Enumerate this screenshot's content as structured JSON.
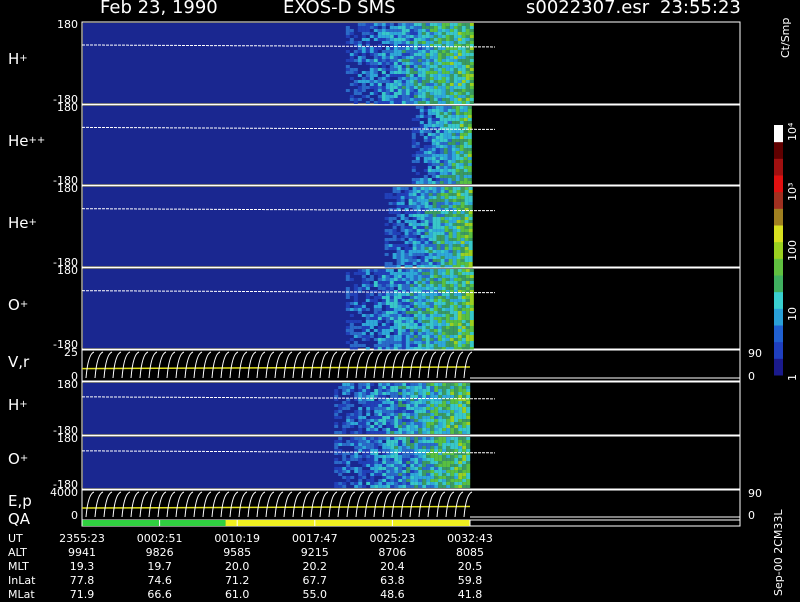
{
  "header": {
    "date": "Feb 23, 1990",
    "instrument": "EXOS-D SMS",
    "file": "s0022307.esr",
    "time": "23:55:23"
  },
  "panels": [
    {
      "name": "H",
      "sup": "+",
      "ymax": "180",
      "ymin": "-180",
      "type": "spectrogram"
    },
    {
      "name": "He",
      "sup": "++",
      "ymax": "180",
      "ymin": "-180",
      "type": "spectrogram"
    },
    {
      "name": "He",
      "sup": "+",
      "ymax": "180",
      "ymin": "-180",
      "type": "spectrogram"
    },
    {
      "name": "O",
      "sup": "+",
      "ymax": "180",
      "ymin": "-180",
      "type": "spectrogram"
    },
    {
      "name": "V,r",
      "sup": "",
      "ymax": "25",
      "ymin": "0",
      "right_max": "90",
      "right_min": "0",
      "type": "line"
    },
    {
      "name": "H",
      "sup": "+",
      "ymax": "180",
      "ymin": "-180",
      "type": "spectrogram"
    },
    {
      "name": "O",
      "sup": "+",
      "ymax": "180",
      "ymin": "-180",
      "type": "spectrogram"
    },
    {
      "name": "E,p",
      "sup": "",
      "ymax": "4000",
      "ymin": "0",
      "right_max": "90",
      "right_min": "0",
      "type": "line"
    },
    {
      "name": "QA",
      "sup": "",
      "type": "quality"
    }
  ],
  "colorbar": {
    "unit": "Ct/Smp",
    "ticks": [
      {
        "label": "1",
        "value": 1
      },
      {
        "label": "10",
        "value": 10
      },
      {
        "label": "100",
        "value": 100
      },
      {
        "label": "10³",
        "value": 1000
      },
      {
        "label": "10⁴",
        "value": 10000
      }
    ],
    "colors": [
      "#1a1a8c",
      "#1f3fbf",
      "#2060d0",
      "#2aa0d8",
      "#3ad0d0",
      "#40b060",
      "#60c040",
      "#9ad020",
      "#d8e020",
      "#a08020",
      "#a03020",
      "#e01010",
      "#a01010",
      "#600000",
      "#ffffff"
    ]
  },
  "footer": {
    "rows": [
      {
        "name": "UT",
        "values": [
          "2355:23",
          "0002:51",
          "0010:19",
          "0017:47",
          "0025:23",
          "0032:43"
        ]
      },
      {
        "name": "ALT",
        "values": [
          "9941",
          "9826",
          "9585",
          "9215",
          "8706",
          "8085"
        ]
      },
      {
        "name": "MLT",
        "values": [
          "19.3",
          "19.7",
          "20.0",
          "20.2",
          "20.4",
          "20.5"
        ]
      },
      {
        "name": "InLat",
        "values": [
          "77.8",
          "74.6",
          "71.2",
          "67.7",
          "63.8",
          "59.8"
        ]
      },
      {
        "name": "MLat",
        "values": [
          "71.9",
          "66.6",
          "61.0",
          "55.0",
          "48.6",
          "41.8"
        ]
      }
    ],
    "date_label": "Sep-00  2CM33L"
  },
  "chart_data": {
    "type": "heatmap",
    "title": "Feb 23, 1990   EXOS-D SMS",
    "x_ticks": [
      "2355:23",
      "0002:51",
      "0010:19",
      "0017:47",
      "0025:23",
      "0032:43"
    ],
    "data_end_time": "0032:43",
    "series": [
      {
        "name": "H+",
        "ylim": [
          -180,
          180
        ],
        "active_start_fraction": 0.68,
        "active_end_fraction": 1.0
      },
      {
        "name": "He++",
        "ylim": [
          -180,
          180
        ],
        "active_start_fraction": 0.85,
        "active_end_fraction": 1.0
      },
      {
        "name": "He+",
        "ylim": [
          -180,
          180
        ],
        "active_start_fraction": 0.78,
        "active_end_fraction": 1.0
      },
      {
        "name": "O+",
        "ylim": [
          -180,
          180
        ],
        "active_start_fraction": 0.68,
        "active_end_fraction": 1.0
      },
      {
        "name": "H+",
        "ylim": [
          -180,
          180
        ],
        "active_start_fraction": 0.65,
        "active_end_fraction": 1.0
      },
      {
        "name": "O+",
        "ylim": [
          -180,
          180
        ],
        "active_start_fraction": 0.65,
        "active_end_fraction": 1.0
      }
    ],
    "quality_segments": [
      {
        "color": "#30d040",
        "end_fraction": 0.37
      },
      {
        "color": "#f0f020",
        "end_fraction": 1.0
      }
    ]
  }
}
